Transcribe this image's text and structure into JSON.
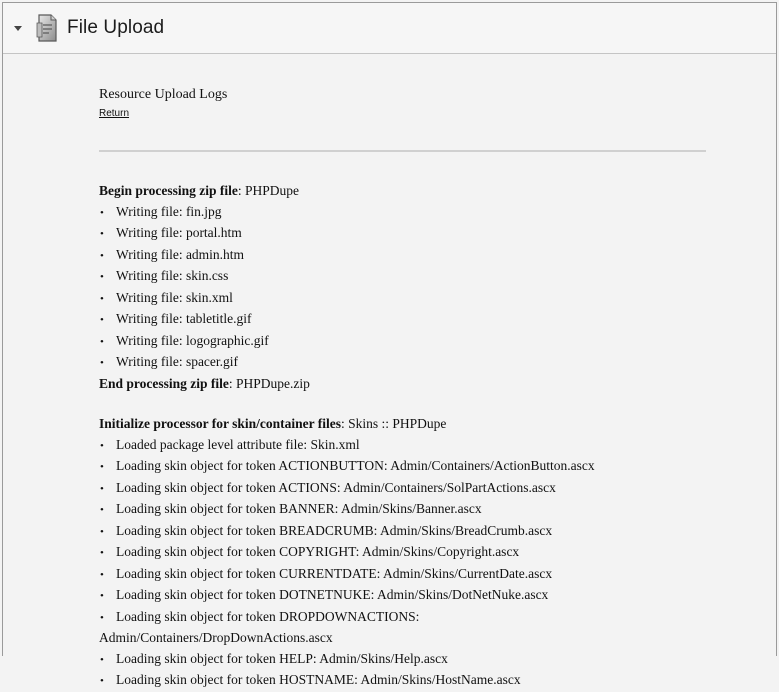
{
  "module": {
    "title": "File Upload",
    "icon": "file-upload-icon"
  },
  "page": {
    "heading": "Resource Upload Logs",
    "return_link": "Return"
  },
  "zip_processing": {
    "begin_label": "Begin processing zip file",
    "begin_value": ": PHPDupe",
    "items": [
      "Writing file: fin.jpg",
      "Writing file: portal.htm",
      "Writing file: admin.htm",
      "Writing file: skin.css",
      "Writing file: skin.xml",
      "Writing file: tabletitle.gif",
      "Writing file: logographic.gif",
      "Writing file: spacer.gif"
    ],
    "end_label": "End processing zip file",
    "end_value": ": PHPDupe.zip"
  },
  "skin_processing": {
    "init_label": "Initialize processor for skin/container files",
    "init_value": ": Skins :: PHPDupe",
    "items": [
      "Loaded package level attribute file: Skin.xml",
      "Loading skin object for token ACTIONBUTTON: Admin/Containers/ActionButton.ascx",
      "Loading skin object for token ACTIONS: Admin/Containers/SolPartActions.ascx",
      "Loading skin object for token BANNER: Admin/Skins/Banner.ascx",
      "Loading skin object for token BREADCRUMB: Admin/Skins/BreadCrumb.ascx",
      "Loading skin object for token COPYRIGHT: Admin/Skins/Copyright.ascx",
      "Loading skin object for token CURRENTDATE: Admin/Skins/CurrentDate.ascx",
      "Loading skin object for token DOTNETNUKE: Admin/Skins/DotNetNuke.ascx",
      "Loading skin object for token DROPDOWNACTIONS:",
      "Loading skin object for token HELP: Admin/Skins/Help.ascx",
      "Loading skin object for token HOSTNAME: Admin/Skins/HostName.ascx"
    ],
    "continuation": "Admin/Containers/DropDownActions.ascx",
    "bullet": "•"
  }
}
